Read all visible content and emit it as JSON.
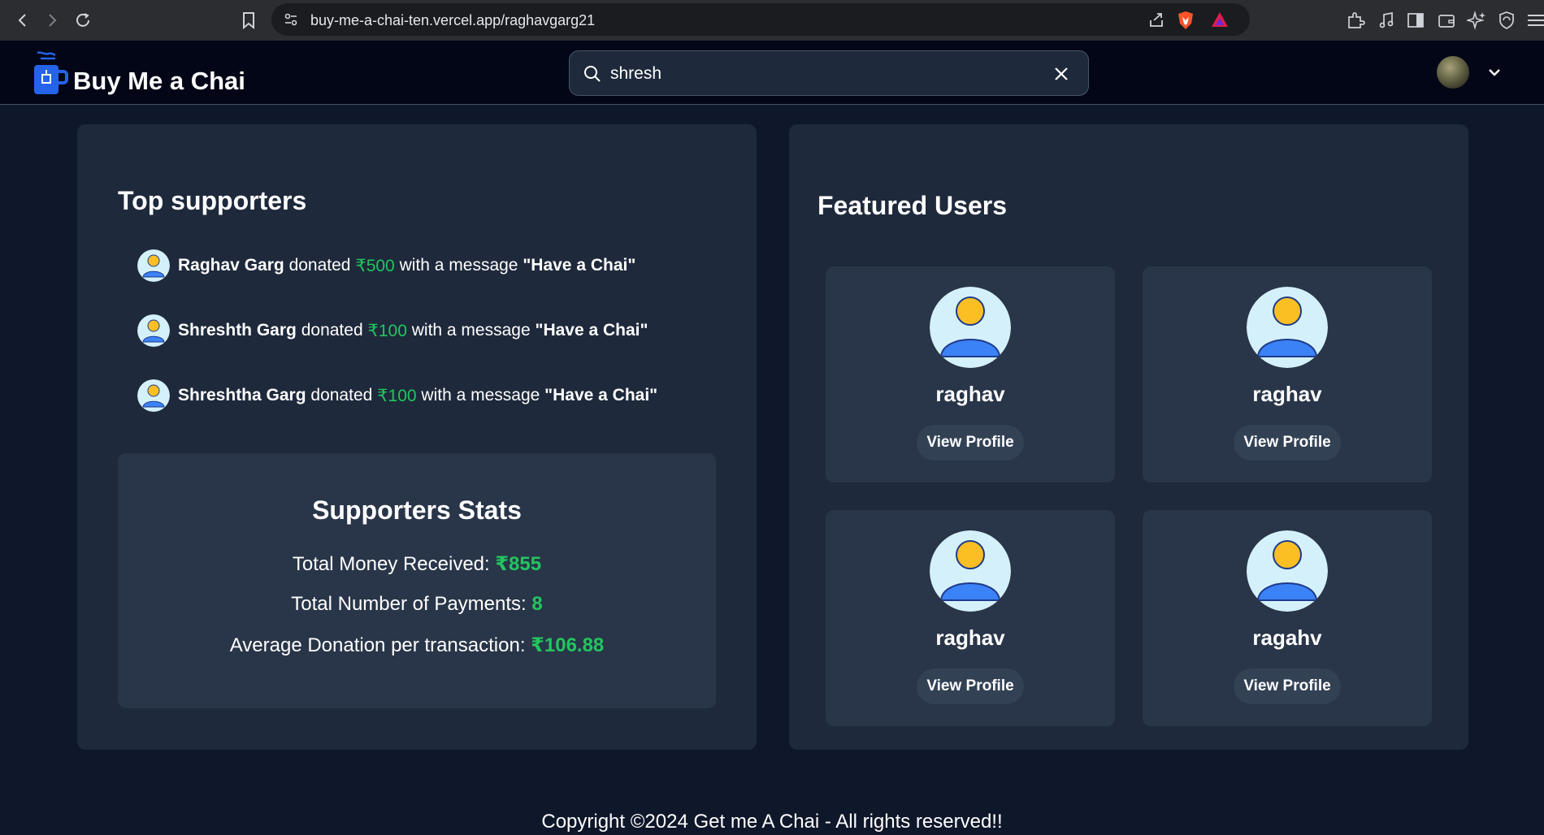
{
  "browser": {
    "url": "buy-me-a-chai-ten.vercel.app/raghavgarg21"
  },
  "header": {
    "brand": "Buy Me a Chai",
    "search_value": "shresh"
  },
  "supporters": {
    "title": "Top supporters",
    "donated_word": "donated",
    "message_prefix": "with a message",
    "items": [
      {
        "name": "Raghav Garg",
        "amount": "₹500",
        "message": "\"Have a Chai\""
      },
      {
        "name": "Shreshth Garg",
        "amount": "₹100",
        "message": "\"Have a Chai\""
      },
      {
        "name": "Shreshtha Garg",
        "amount": "₹100",
        "message": "\"Have a Chai\""
      }
    ]
  },
  "stats": {
    "title": "Supporters Stats",
    "total_money_label": "Total Money Received:",
    "total_money_value": "₹855",
    "total_payments_label": "Total Number of Payments:",
    "total_payments_value": "8",
    "average_label": "Average Donation per transaction:",
    "average_value": "₹106.88"
  },
  "featured": {
    "title": "Featured Users",
    "button_label": "View Profile",
    "users": [
      {
        "name": "raghav"
      },
      {
        "name": "raghav"
      },
      {
        "name": "raghav"
      },
      {
        "name": "ragahv"
      }
    ]
  },
  "footer": {
    "text": "Copyright ©2024 Get me A Chai - All rights reserved!!"
  },
  "colors": {
    "accent_green": "#22c55e",
    "panel": "#1e293b",
    "background": "#0f172a"
  }
}
